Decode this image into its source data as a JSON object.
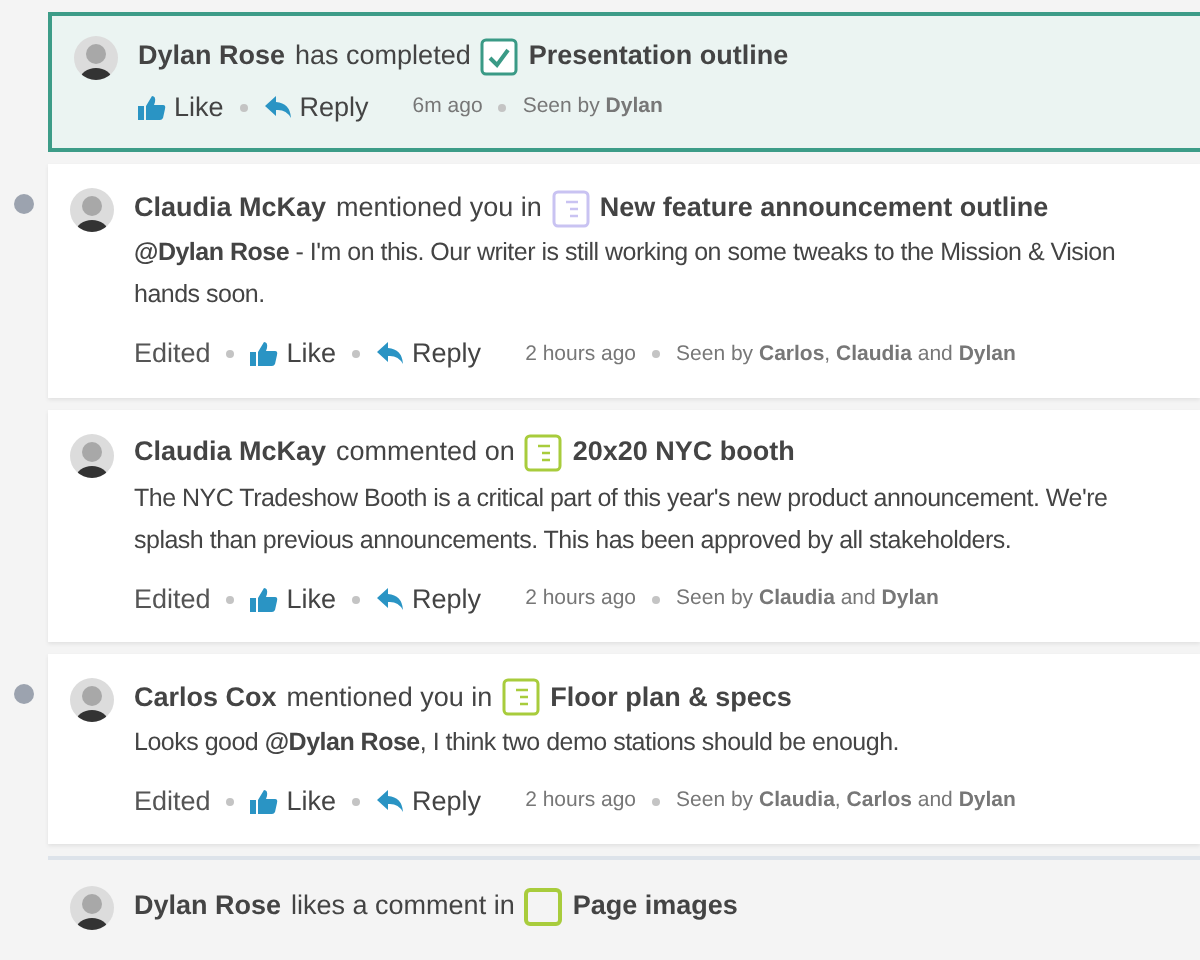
{
  "feed": [
    {
      "unread": false,
      "kind": "highlighted",
      "actor": "Dylan Rose",
      "verb": "has completed",
      "doc_icon": {
        "kind": "check",
        "color": "#3a9a86"
      },
      "doc_title": "Presentation outline",
      "actions": [
        "Like",
        "Reply"
      ],
      "time": "6m ago",
      "seen_by": "Seen by **Dylan**"
    },
    {
      "unread": true,
      "kind": "card",
      "actor": "Claudia McKay",
      "verb": "mentioned you in",
      "doc_icon": {
        "kind": "doc",
        "color": "#c9c3f2"
      },
      "doc_title": "New feature announcement outline",
      "body_lines": [
        "**@Dylan Rose** - I'm on this. Our writer is still working on some tweaks to the Mission & Vision",
        "hands soon."
      ],
      "edited_label": "Edited",
      "actions": [
        "Like",
        "Reply"
      ],
      "time": "2 hours ago",
      "seen_by": "Seen by **Carlos**, **Claudia** and **Dylan**"
    },
    {
      "unread": false,
      "kind": "card",
      "actor": "Claudia McKay",
      "verb": "commented on",
      "doc_icon": {
        "kind": "doc",
        "color": "#a8cc3c"
      },
      "doc_title": "20x20 NYC booth",
      "body_lines": [
        "The NYC Tradeshow Booth is a critical part of this year's new product announcement. We're",
        "splash than previous announcements. This has been approved by all stakeholders."
      ],
      "edited_label": "Edited",
      "actions": [
        "Like",
        "Reply"
      ],
      "time": "2 hours ago",
      "seen_by": "Seen by **Claudia** and **Dylan**"
    },
    {
      "unread": true,
      "kind": "card",
      "actor": "Carlos Cox",
      "verb": "mentioned you in",
      "doc_icon": {
        "kind": "doc",
        "color": "#a8cc3c"
      },
      "doc_title": "Floor plan & specs",
      "body_lines": [
        "Looks good **@Dylan Rose**, I think two demo stations should be enough."
      ],
      "edited_label": "Edited",
      "actions": [
        "Like",
        "Reply"
      ],
      "time": "2 hours ago",
      "seen_by": "Seen by **Claudia**, **Carlos** and **Dylan**"
    },
    {
      "unread": false,
      "kind": "plain",
      "actor": "Dylan Rose",
      "verb": "likes a comment in",
      "doc_icon": {
        "kind": "blank",
        "color": "#a8cc3c"
      },
      "doc_title": "Page images"
    }
  ]
}
